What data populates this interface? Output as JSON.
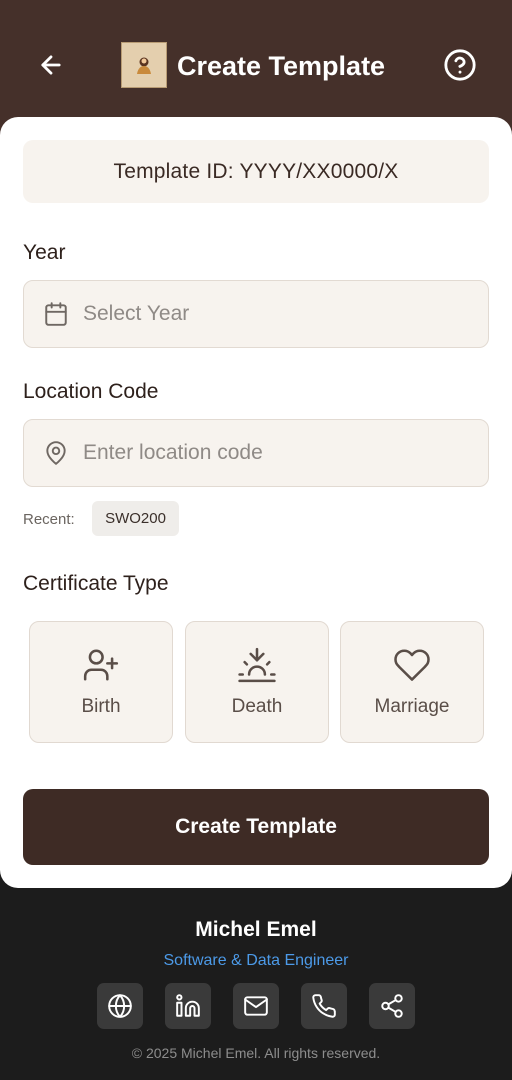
{
  "header": {
    "title": "Create Template",
    "back_icon": "arrow-left-icon",
    "help_icon": "help-circle-icon",
    "background": "#45302a"
  },
  "form": {
    "template_id": "Template ID: YYYY/XX0000/X",
    "year": {
      "label": "Year",
      "placeholder": "Select Year",
      "icon": "calendar-icon"
    },
    "location": {
      "label": "Location Code",
      "placeholder": "Enter location code",
      "icon": "map-pin-icon"
    },
    "recent": {
      "label": "Recent:",
      "items": [
        "SWO200"
      ]
    },
    "certificate_type": {
      "label": "Certificate Type",
      "options": [
        {
          "label": "Birth",
          "icon": "user-plus-icon"
        },
        {
          "label": "Death",
          "icon": "sunset-icon"
        },
        {
          "label": "Marriage",
          "icon": "heart-icon"
        }
      ]
    },
    "submit_label": "Create Template",
    "accent": "#3e2b25"
  },
  "footer": {
    "name": "Michel Emel",
    "role": "Software & Data Engineer",
    "role_color": "#4c9ae8",
    "social_icons": [
      "globe-icon",
      "linkedin-icon",
      "mail-icon",
      "phone-icon",
      "share-icon"
    ],
    "copyright": "© 2025 Michel Emel. All rights reserved."
  }
}
